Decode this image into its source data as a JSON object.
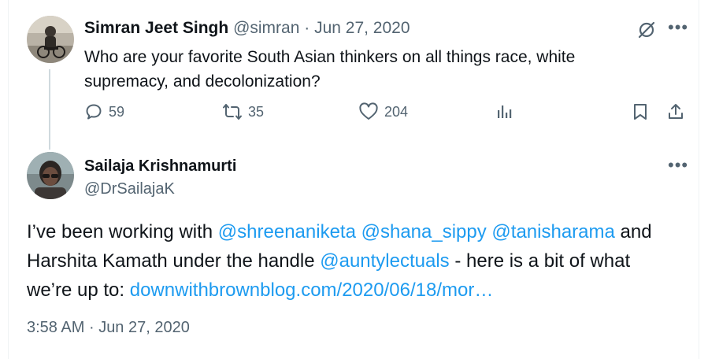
{
  "tweet1": {
    "author_name": "Simran Jeet Singh",
    "handle": "@simran",
    "separator": "·",
    "date": "Jun 27, 2020",
    "text": "Who are your favorite South Asian thinkers on all things race, white supremacy, and decolonization?",
    "actions": {
      "reply_count": "59",
      "retweet_count": "35",
      "like_count": "204"
    },
    "icons": [
      "grok-icon",
      "more-icon",
      "reply-icon",
      "retweet-icon",
      "like-icon",
      "views-icon",
      "bookmark-icon",
      "share-icon"
    ]
  },
  "tweet2": {
    "author_name": "Sailaja Krishnamurti",
    "handle": "@DrSailajaK",
    "text_parts": {
      "p1": "I’ve been working with ",
      "m1": "@shreenaniketa",
      "s1": " ",
      "m2": "@shana_sippy",
      "s2": " ",
      "m3": "@tanisharama",
      "p2": " and Harshita Kamath under the handle ",
      "m4": "@auntylectuals",
      "p3": " - here is a bit of what we’re up to: ",
      "link": "downwithbrownblog.com/2020/06/18/mor…"
    },
    "time": "3:58 AM",
    "separator": "·",
    "date": "Jun 27, 2020",
    "icons": [
      "more-icon"
    ]
  },
  "colors": {
    "link": "#1d9bf0",
    "muted": "#536471",
    "text": "#0f1419",
    "thread_line": "#cfd9de"
  }
}
